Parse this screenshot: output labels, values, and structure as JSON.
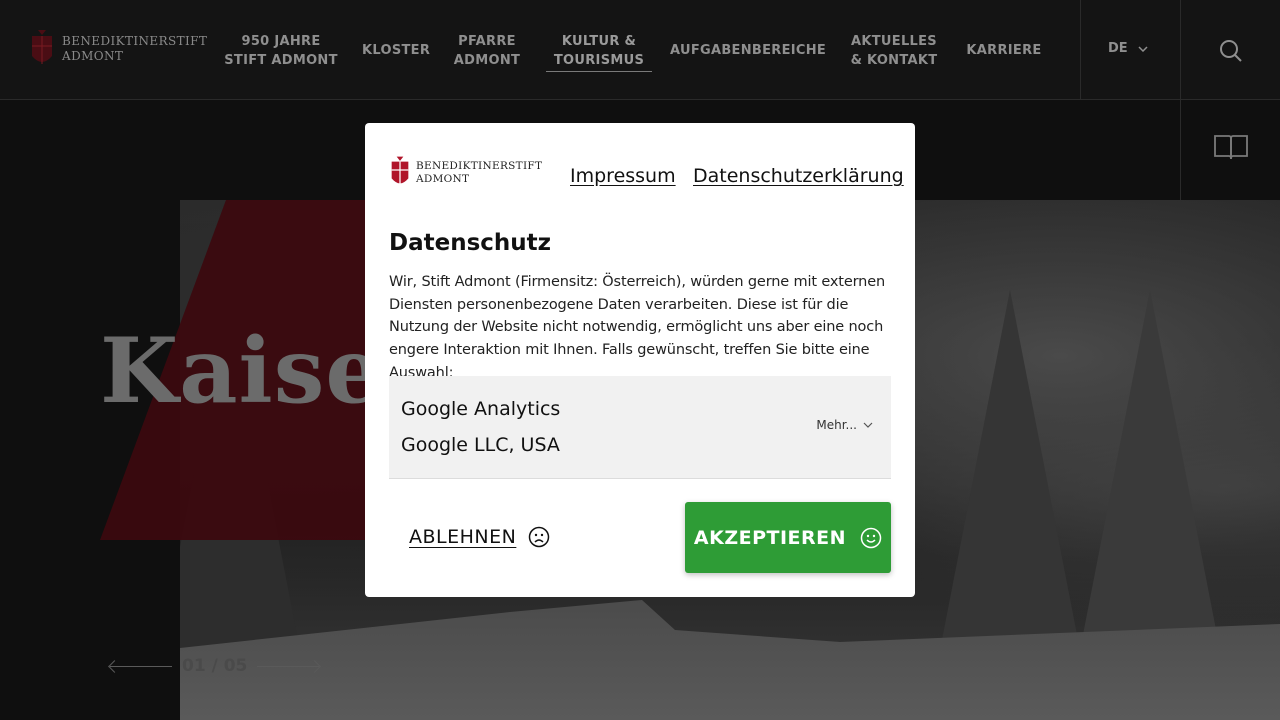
{
  "header": {
    "logo_line1": "BENEDIKTINERSTIFT",
    "logo_line2": "ADMONT",
    "nav": [
      {
        "label": "950 JAHRE STIFT ADMONT"
      },
      {
        "label": "KLOSTER"
      },
      {
        "label": "PFARRE ADMONT"
      },
      {
        "label": "KULTUR & TOURISMUS",
        "active": true
      },
      {
        "label": "AUFGABENBEREICHE"
      },
      {
        "label": "AKTUELLES & KONTAKT"
      },
      {
        "label": "KARRIERE"
      }
    ],
    "language": "DE",
    "search_icon": "search-icon",
    "book_icon": "book-icon"
  },
  "hero": {
    "title": "Kaiser",
    "pager": "01 / 05"
  },
  "consent": {
    "logo_line1": "BENEDIKTINERSTIFT",
    "logo_line2": "ADMONT",
    "impressum": "Impressum",
    "privacy_policy": "Datenschutzerklärung",
    "title": "Datenschutz",
    "text": "Wir, Stift Admont (Firmensitz: Österreich), würden gerne mit externen Diensten personenbezogene Daten verarbeiten. Diese ist für die Nutzung der Website nicht notwendig, ermöglicht uns aber eine noch engere Interaktion mit Ihnen. Falls gewünscht, treffen Sie bitte eine Auswahl:",
    "service": {
      "name": "Google Analytics",
      "company": "Google LLC, USA",
      "more": "Mehr..."
    },
    "decline": "ABLEHNEN",
    "accept": "AKZEPTIEREN",
    "accept_color": "#2e9c36"
  }
}
